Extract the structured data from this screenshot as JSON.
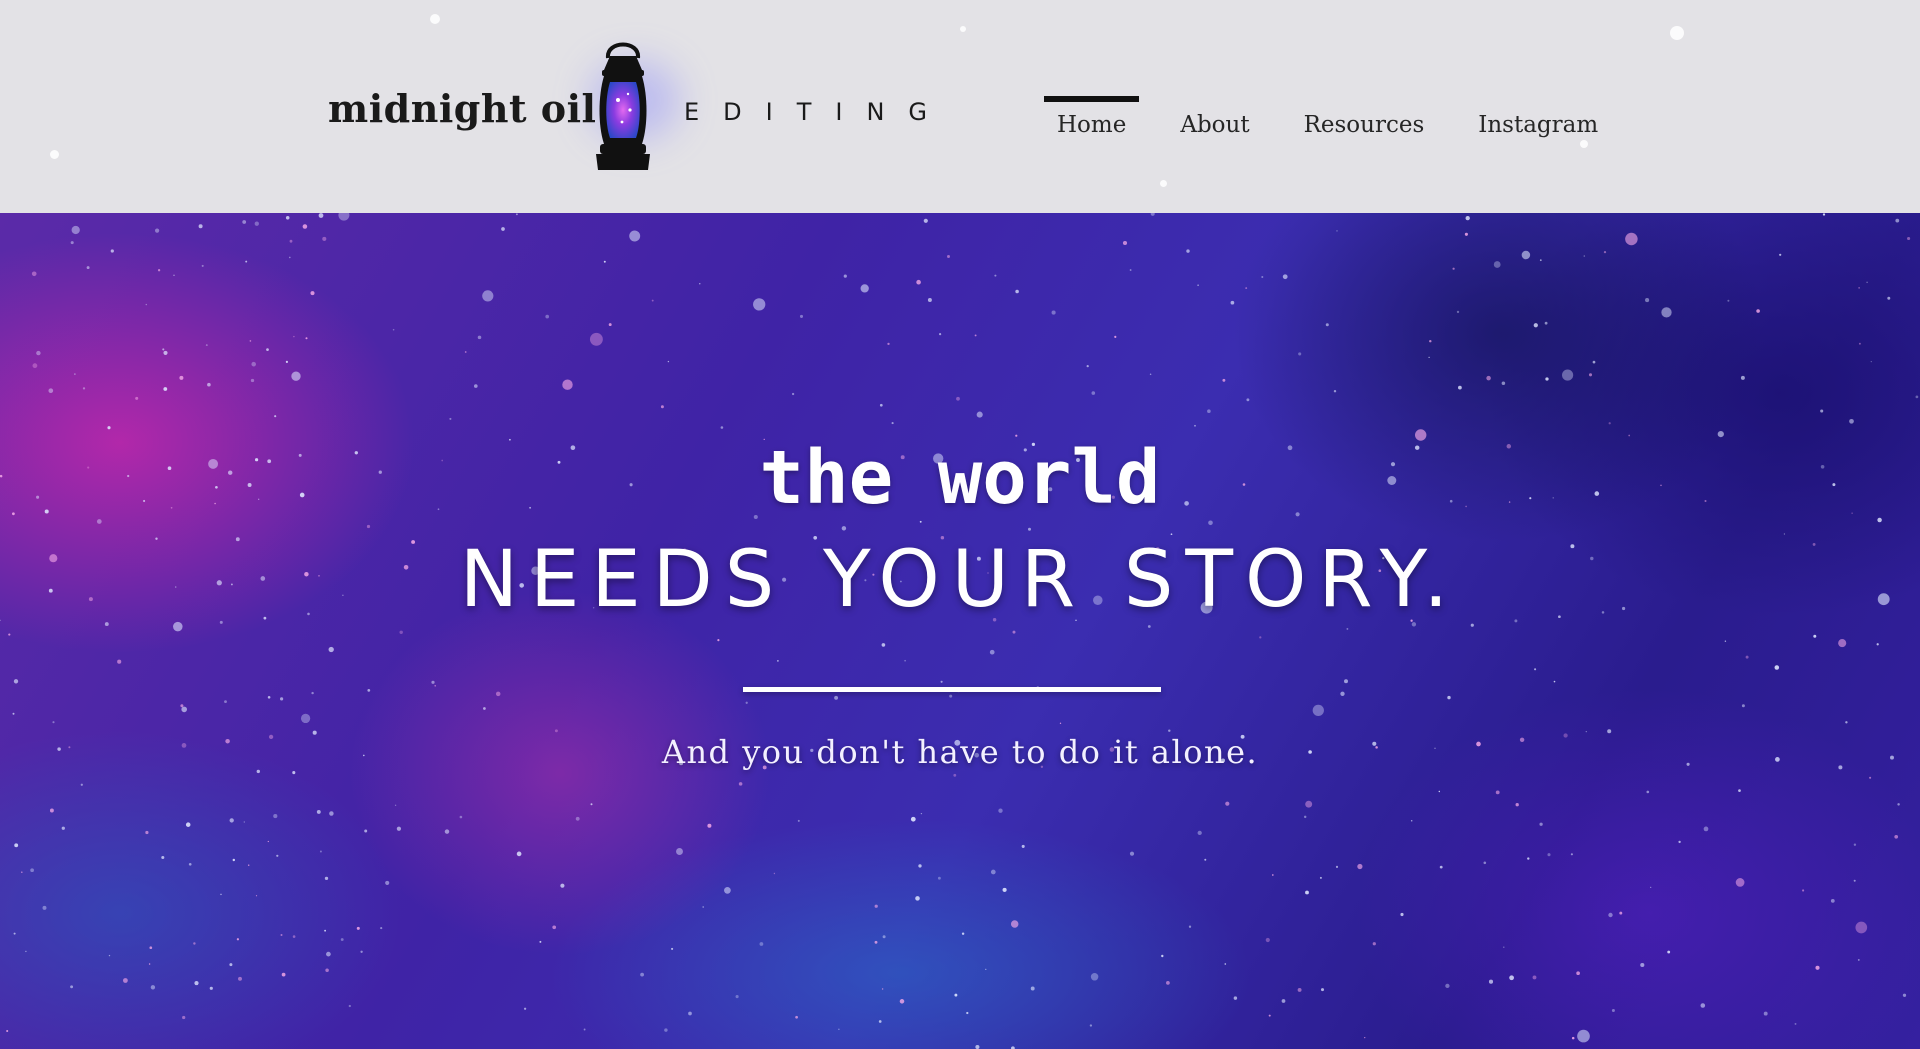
{
  "header": {
    "brand_left": "midnight oil",
    "brand_right": "EDITING",
    "logo_icon": "lantern-icon",
    "nav": {
      "items": [
        {
          "label": "Home",
          "active": true
        },
        {
          "label": "About",
          "active": false
        },
        {
          "label": "Resources",
          "active": false
        },
        {
          "label": "Instagram",
          "active": false
        }
      ]
    }
  },
  "hero": {
    "line1": "the world",
    "line2": "NEEDS YOUR STORY.",
    "subtitle": "And you don't have to do it alone."
  },
  "colors": {
    "header_bg": "#e3e2e6",
    "hero_purple": "#3f23a6",
    "hero_magenta": "#d228aa",
    "hero_blue": "#286ec8",
    "text_dark": "#1a1a1a",
    "text_light": "#ffffff"
  }
}
